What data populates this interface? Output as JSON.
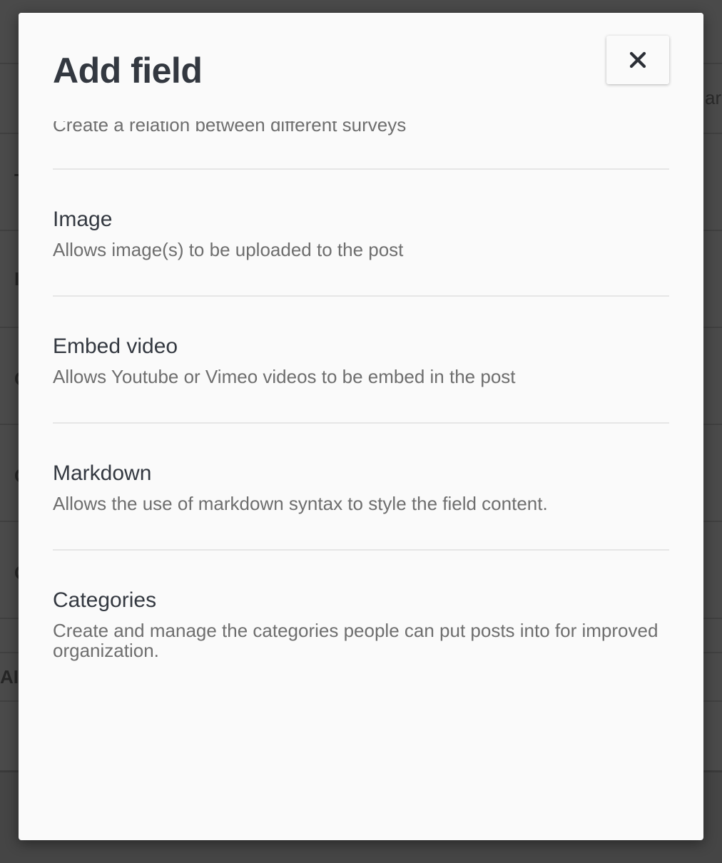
{
  "background": {
    "peek_text": "ar",
    "glyphs": [
      "T",
      "I",
      "C",
      "C",
      "C",
      "AI"
    ]
  },
  "modal": {
    "title": "Add field",
    "close_symbol": "✕",
    "partial_item_description": "Create a relation between different surveys",
    "options": [
      {
        "title": "Image",
        "description": "Allows image(s) to be uploaded to the post"
      },
      {
        "title": "Embed video",
        "description": "Allows Youtube or Vimeo videos to be embed in the post"
      },
      {
        "title": "Markdown",
        "description": "Allows the use of markdown syntax to style the field content."
      },
      {
        "title": "Categories",
        "description": "Create and manage the categories people can put posts into for improved organization."
      }
    ]
  },
  "colors": {
    "overlay": "#454545",
    "modal_background": "#fafafa",
    "title_text": "#333840",
    "description_text": "#6e6e6e",
    "divider": "#e6e6e6"
  }
}
